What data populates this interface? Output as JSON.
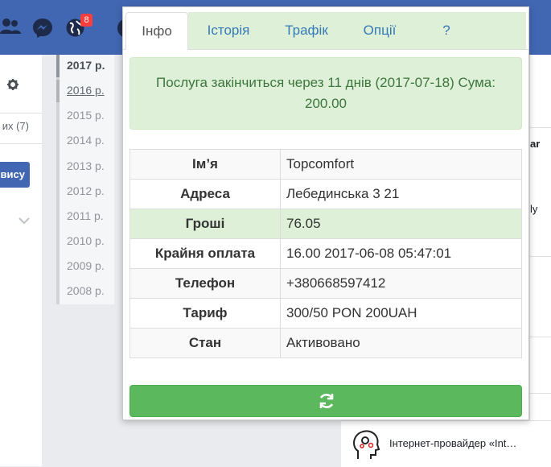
{
  "facebook": {
    "notification_count": "8",
    "left_panel": {
      "count_text": "их (7)",
      "button_label": "вису"
    },
    "years": [
      "2017 р.",
      "2016 р.",
      "2015 р.",
      "2014 р.",
      "2013 р.",
      "2012 р.",
      "2011 р.",
      "2010 р.",
      "2009 р.",
      "2008 р."
    ],
    "right_panel": {
      "text_1": "ar",
      "text_2": "ly"
    },
    "bottom_card_text": "Інтернет-провайдер «Int…"
  },
  "popup": {
    "tabs": [
      {
        "label": "Інфо",
        "active": true
      },
      {
        "label": "Історія",
        "active": false
      },
      {
        "label": "Трафік",
        "active": false
      },
      {
        "label": "Опції",
        "active": false
      },
      {
        "label": "?",
        "active": false
      }
    ],
    "alert_text": "Послуга закінчиться через 11 днів (2017-07-18) Сума: 200.00",
    "info_rows": [
      {
        "key": "Ім’я",
        "value": "Topcomfort"
      },
      {
        "key": "Адреса",
        "value": "Лебединська 3 21"
      },
      {
        "key": "Гроші",
        "value": "76.05"
      },
      {
        "key": "Крайня оплата",
        "value": "16.00 2017-06-08 05:47:01"
      },
      {
        "key": "Телефон",
        "value": "+380668597412"
      },
      {
        "key": "Тариф",
        "value": "300/50 PON 200UAH"
      },
      {
        "key": "Стан",
        "value": "Активовано"
      }
    ],
    "refresh_icon": "refresh-icon"
  },
  "colors": {
    "facebook_blue": "#4267b2",
    "tab_bg": "#dff0d8",
    "link": "#337ab7",
    "alert_text": "#3c763d",
    "button_green": "#5cb85c"
  }
}
